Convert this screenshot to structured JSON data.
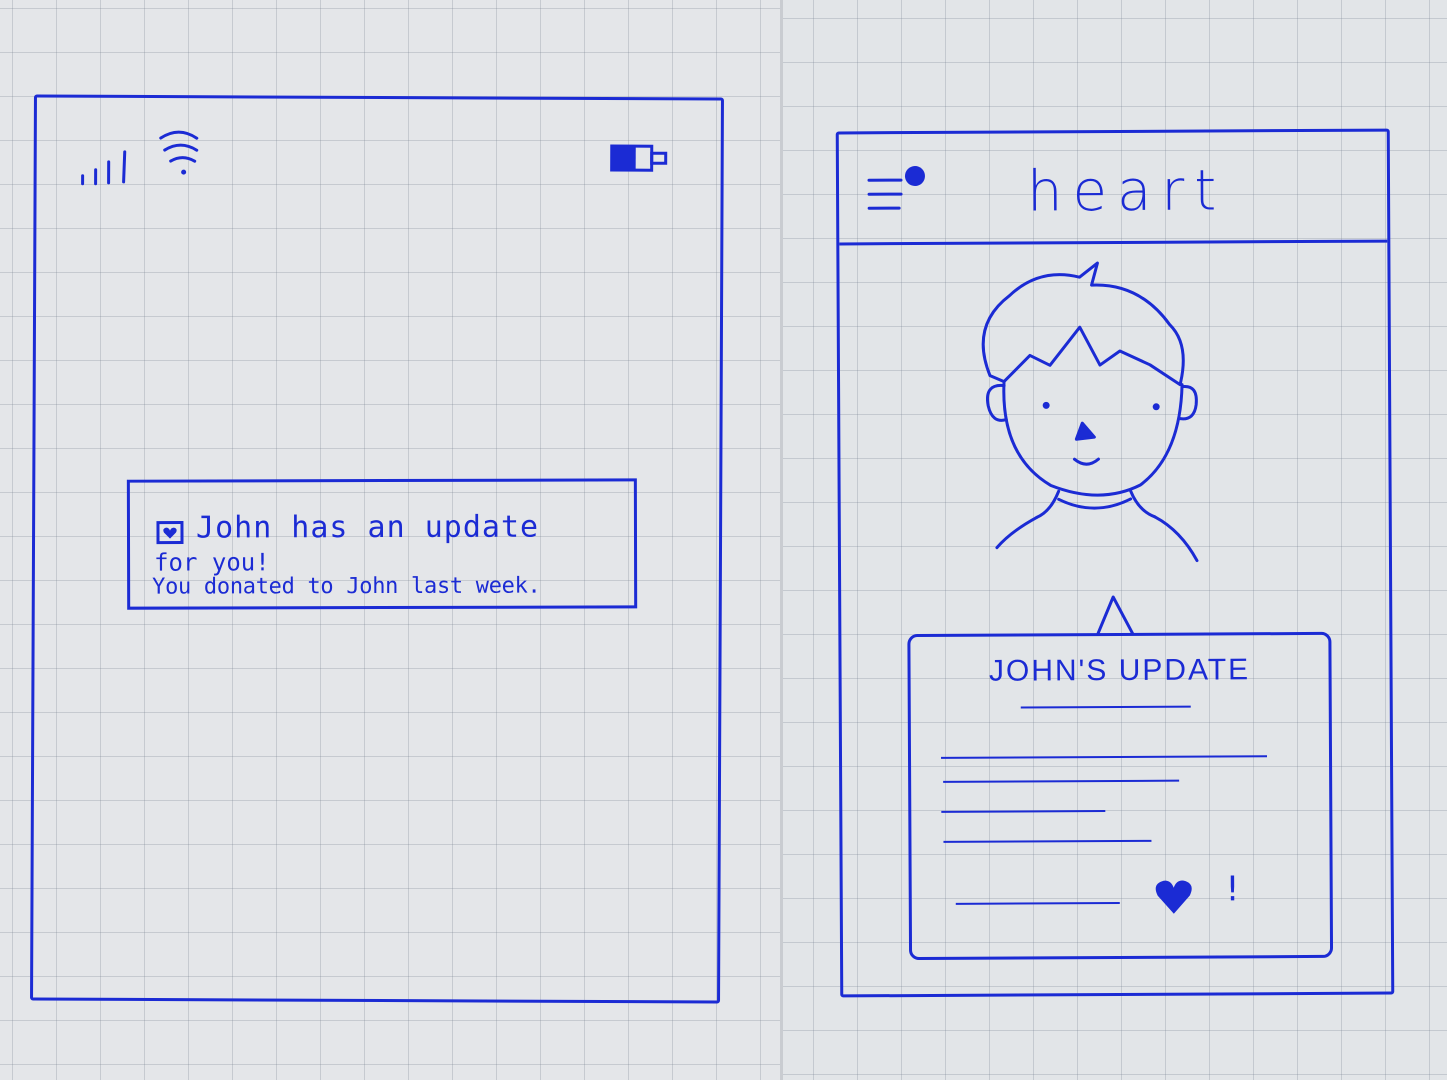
{
  "notification_screen": {
    "status_bar": {
      "signal_icon": "signal-bars-icon",
      "wifi_icon": "wifi-icon",
      "battery_icon": "battery-icon"
    },
    "notification": {
      "icon": "heart-app-icon",
      "title_line1": "John has an update",
      "title_line2": "for you!",
      "body": "You donated to John last week."
    }
  },
  "app_screen": {
    "header": {
      "menu_icon": "hamburger-menu-icon",
      "title": "heart"
    },
    "avatar": "john-avatar",
    "update_card": {
      "title": "JOHN'S UPDATE",
      "reaction": "!"
    }
  },
  "colors": {
    "ink": "#1b2bd4",
    "paper": "#e4e6e9",
    "grid": "#9aa2ad"
  }
}
